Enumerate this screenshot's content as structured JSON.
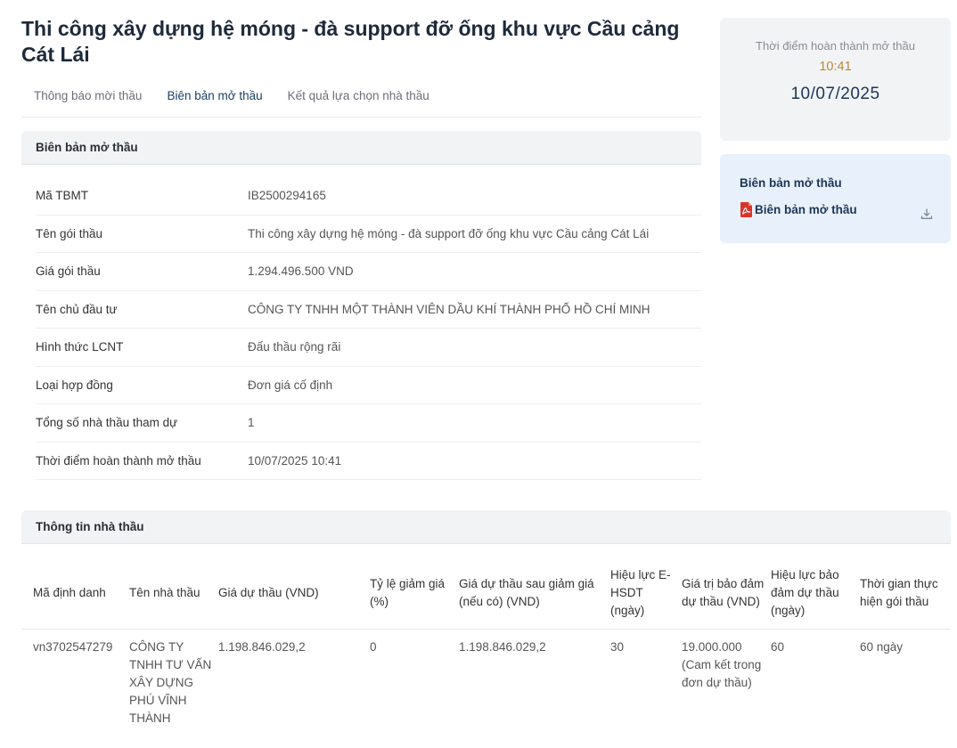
{
  "page": {
    "title": "Thi công xây dựng hệ móng - đà support đỡ ống khu vực Cầu cảng Cát Lái"
  },
  "tabs": [
    {
      "label": "Thông báo mời thầu"
    },
    {
      "label": "Biên bản mở thầu"
    },
    {
      "label": "Kết quả lựa chọn nhà thầu"
    }
  ],
  "opening_section": {
    "title": "Biên bản mở thầu",
    "rows": [
      {
        "label": "Mã TBMT",
        "value": "IB2500294165"
      },
      {
        "label": "Tên gói thầu",
        "value": "Thi công xây dựng hệ móng - đà support đỡ ống khu vực Cầu cảng Cát Lái"
      },
      {
        "label": "Giá gói thầu",
        "value": "1.294.496.500 VND"
      },
      {
        "label": "Tên chủ đầu tư",
        "value": "CÔNG TY TNHH MỘT THÀNH VIÊN DẦU KHÍ THÀNH PHỐ HỒ CHÍ MINH"
      },
      {
        "label": "Hình thức LCNT",
        "value": "Đấu thầu rộng rãi"
      },
      {
        "label": "Loại hợp đồng",
        "value": "Đơn giá cố định"
      },
      {
        "label": "Tổng số nhà thầu tham dự",
        "value": "1"
      },
      {
        "label": "Thời điểm hoàn thành mở thầu",
        "value": "10/07/2025 10:41"
      }
    ]
  },
  "side_time": {
    "label": "Thời điểm hoàn thành mở thầu",
    "time": "10:41",
    "date": "10/07/2025"
  },
  "side_doc": {
    "title": "Biên bản mở thầu",
    "file_label": "Biên bản mở thầu",
    "file_icon": "pdf-icon",
    "action_icon": "download-icon"
  },
  "bidder_section": {
    "title": "Thông tin nhà thầu",
    "columns": [
      "Mã định danh",
      "Tên nhà thầu",
      "Giá dự thầu (VND)",
      "Tỷ lệ giảm giá (%)",
      "Giá dự thầu sau giảm giá (nếu có) (VND)",
      "Hiệu lực E-HSDT (ngày)",
      "Giá trị bảo đảm dự thầu (VND)",
      "Hiệu lực bảo đảm dự thầu (ngày)",
      "Thời gian thực hiện gói thầu"
    ],
    "rows": [
      {
        "id": "vn3702547279",
        "name": "CÔNG TY TNHH TƯ VẤN XÂY DỰNG PHÚ VĨNH THÀNH",
        "bid_price": "1.198.846.029,2",
        "discount": "0",
        "price_after_discount": "1.198.846.029,2",
        "validity": "30",
        "security_value": "19.000.000",
        "security_note": "(Cam kết trong đơn dự thầu)",
        "security_validity": "60",
        "duration": "60 ngày"
      }
    ]
  },
  "colors": {
    "title": "#1e2a3a",
    "time_accent": "#b8893a",
    "date": "#1d3557",
    "pdf": "#d9352b",
    "doc_panel": "#e8f1fb"
  }
}
